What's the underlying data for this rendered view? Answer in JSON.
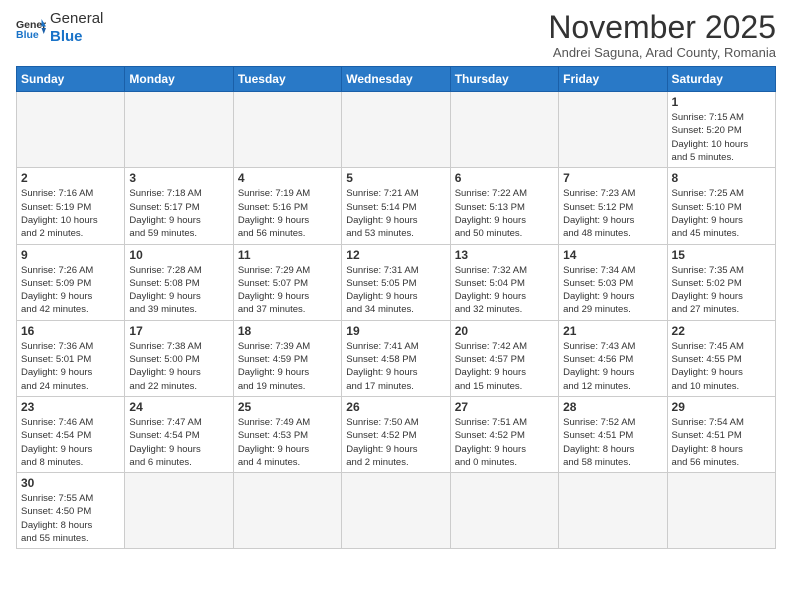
{
  "header": {
    "logo_general": "General",
    "logo_blue": "Blue",
    "month_title": "November 2025",
    "subtitle": "Andrei Saguna, Arad County, Romania"
  },
  "weekdays": [
    "Sunday",
    "Monday",
    "Tuesday",
    "Wednesday",
    "Thursday",
    "Friday",
    "Saturday"
  ],
  "days": [
    {
      "num": "",
      "info": "",
      "empty": true
    },
    {
      "num": "",
      "info": "",
      "empty": true
    },
    {
      "num": "",
      "info": "",
      "empty": true
    },
    {
      "num": "",
      "info": "",
      "empty": true
    },
    {
      "num": "",
      "info": "",
      "empty": true
    },
    {
      "num": "",
      "info": "",
      "empty": true
    },
    {
      "num": "1",
      "info": "Sunrise: 7:15 AM\nSunset: 5:20 PM\nDaylight: 10 hours\nand 5 minutes."
    },
    {
      "num": "2",
      "info": "Sunrise: 7:16 AM\nSunset: 5:19 PM\nDaylight: 10 hours\nand 2 minutes."
    },
    {
      "num": "3",
      "info": "Sunrise: 7:18 AM\nSunset: 5:17 PM\nDaylight: 9 hours\nand 59 minutes."
    },
    {
      "num": "4",
      "info": "Sunrise: 7:19 AM\nSunset: 5:16 PM\nDaylight: 9 hours\nand 56 minutes."
    },
    {
      "num": "5",
      "info": "Sunrise: 7:21 AM\nSunset: 5:14 PM\nDaylight: 9 hours\nand 53 minutes."
    },
    {
      "num": "6",
      "info": "Sunrise: 7:22 AM\nSunset: 5:13 PM\nDaylight: 9 hours\nand 50 minutes."
    },
    {
      "num": "7",
      "info": "Sunrise: 7:23 AM\nSunset: 5:12 PM\nDaylight: 9 hours\nand 48 minutes."
    },
    {
      "num": "8",
      "info": "Sunrise: 7:25 AM\nSunset: 5:10 PM\nDaylight: 9 hours\nand 45 minutes."
    },
    {
      "num": "9",
      "info": "Sunrise: 7:26 AM\nSunset: 5:09 PM\nDaylight: 9 hours\nand 42 minutes."
    },
    {
      "num": "10",
      "info": "Sunrise: 7:28 AM\nSunset: 5:08 PM\nDaylight: 9 hours\nand 39 minutes."
    },
    {
      "num": "11",
      "info": "Sunrise: 7:29 AM\nSunset: 5:07 PM\nDaylight: 9 hours\nand 37 minutes."
    },
    {
      "num": "12",
      "info": "Sunrise: 7:31 AM\nSunset: 5:05 PM\nDaylight: 9 hours\nand 34 minutes."
    },
    {
      "num": "13",
      "info": "Sunrise: 7:32 AM\nSunset: 5:04 PM\nDaylight: 9 hours\nand 32 minutes."
    },
    {
      "num": "14",
      "info": "Sunrise: 7:34 AM\nSunset: 5:03 PM\nDaylight: 9 hours\nand 29 minutes."
    },
    {
      "num": "15",
      "info": "Sunrise: 7:35 AM\nSunset: 5:02 PM\nDaylight: 9 hours\nand 27 minutes."
    },
    {
      "num": "16",
      "info": "Sunrise: 7:36 AM\nSunset: 5:01 PM\nDaylight: 9 hours\nand 24 minutes."
    },
    {
      "num": "17",
      "info": "Sunrise: 7:38 AM\nSunset: 5:00 PM\nDaylight: 9 hours\nand 22 minutes."
    },
    {
      "num": "18",
      "info": "Sunrise: 7:39 AM\nSunset: 4:59 PM\nDaylight: 9 hours\nand 19 minutes."
    },
    {
      "num": "19",
      "info": "Sunrise: 7:41 AM\nSunset: 4:58 PM\nDaylight: 9 hours\nand 17 minutes."
    },
    {
      "num": "20",
      "info": "Sunrise: 7:42 AM\nSunset: 4:57 PM\nDaylight: 9 hours\nand 15 minutes."
    },
    {
      "num": "21",
      "info": "Sunrise: 7:43 AM\nSunset: 4:56 PM\nDaylight: 9 hours\nand 12 minutes."
    },
    {
      "num": "22",
      "info": "Sunrise: 7:45 AM\nSunset: 4:55 PM\nDaylight: 9 hours\nand 10 minutes."
    },
    {
      "num": "23",
      "info": "Sunrise: 7:46 AM\nSunset: 4:54 PM\nDaylight: 9 hours\nand 8 minutes."
    },
    {
      "num": "24",
      "info": "Sunrise: 7:47 AM\nSunset: 4:54 PM\nDaylight: 9 hours\nand 6 minutes."
    },
    {
      "num": "25",
      "info": "Sunrise: 7:49 AM\nSunset: 4:53 PM\nDaylight: 9 hours\nand 4 minutes."
    },
    {
      "num": "26",
      "info": "Sunrise: 7:50 AM\nSunset: 4:52 PM\nDaylight: 9 hours\nand 2 minutes."
    },
    {
      "num": "27",
      "info": "Sunrise: 7:51 AM\nSunset: 4:52 PM\nDaylight: 9 hours\nand 0 minutes."
    },
    {
      "num": "28",
      "info": "Sunrise: 7:52 AM\nSunset: 4:51 PM\nDaylight: 8 hours\nand 58 minutes."
    },
    {
      "num": "29",
      "info": "Sunrise: 7:54 AM\nSunset: 4:51 PM\nDaylight: 8 hours\nand 56 minutes."
    },
    {
      "num": "30",
      "info": "Sunrise: 7:55 AM\nSunset: 4:50 PM\nDaylight: 8 hours\nand 55 minutes."
    },
    {
      "num": "",
      "info": "",
      "empty": true
    },
    {
      "num": "",
      "info": "",
      "empty": true
    },
    {
      "num": "",
      "info": "",
      "empty": true
    },
    {
      "num": "",
      "info": "",
      "empty": true
    },
    {
      "num": "",
      "info": "",
      "empty": true
    },
    {
      "num": "",
      "info": "",
      "empty": true
    }
  ]
}
